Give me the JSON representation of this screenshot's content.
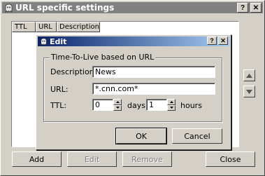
{
  "window": {
    "title": "URL specific settings",
    "help_label": "?",
    "close_label": "✕",
    "columns": [
      "TTL",
      "URL",
      "Description"
    ],
    "buttons": {
      "add": "Add",
      "edit": "Edit",
      "remove": "Remove",
      "close": "Close"
    },
    "icons": {
      "app": "ghost-icon",
      "move_up": "triangle-up-icon",
      "move_down": "triangle-down-icon"
    }
  },
  "dialog": {
    "title": "Edit",
    "help_label": "?",
    "close_label": "✕",
    "group_title": "Time-To-Live based on URL",
    "description_label": "Description:",
    "description_value": "News",
    "url_label": "URL:",
    "url_value": "*.cnn.com*",
    "ttl_label": "TTL:",
    "days_value": "0",
    "days_unit": "days",
    "hours_value": "1",
    "hours_unit": "hours",
    "ok": "OK",
    "cancel": "Cancel"
  },
  "colors": {
    "dialog_title_start": "#0a246a",
    "dialog_title_end": "#a6caf0",
    "inactive_title": "#808080",
    "face": "#d4d0c8"
  }
}
